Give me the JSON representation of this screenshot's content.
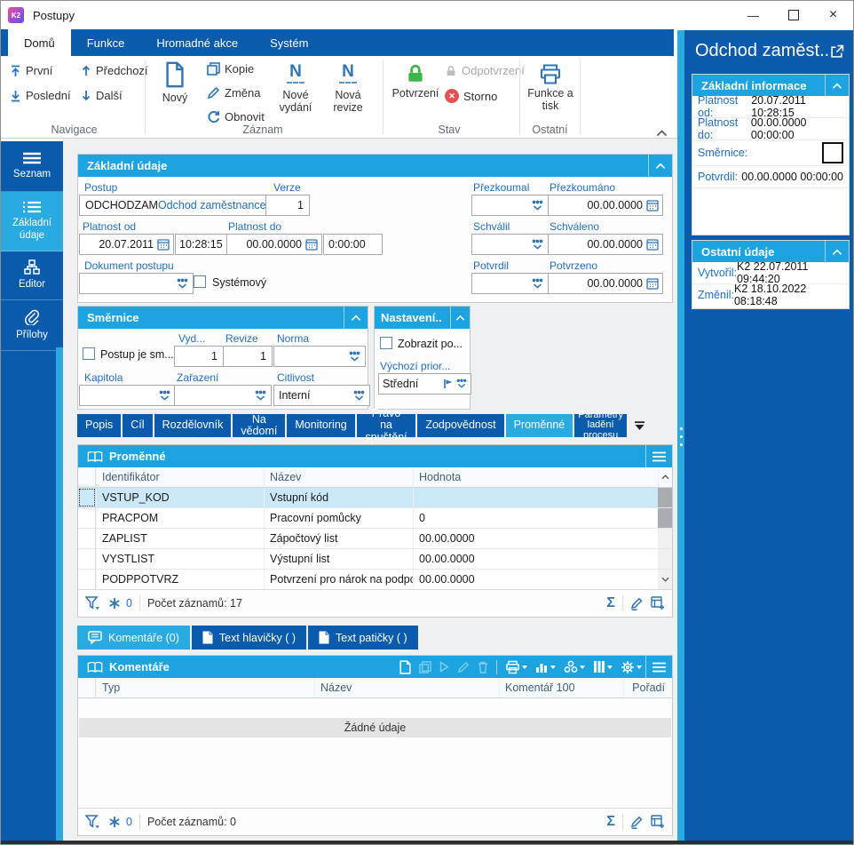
{
  "window": {
    "title": "Postupy",
    "logo_text": "K2"
  },
  "ribbon": {
    "tabs": [
      {
        "label": "Domů"
      },
      {
        "label": "Funkce"
      },
      {
        "label": "Hromadné akce"
      },
      {
        "label": "Systém"
      }
    ],
    "navigace": {
      "label": "Navigace",
      "prvni": "První",
      "posledni": "Poslední",
      "predchozi": "Předchozí",
      "dalsi": "Další"
    },
    "zaznam": {
      "label": "Záznam",
      "novy": "Nový",
      "kopie": "Kopie",
      "zmena": "Změna",
      "obnovit": "Obnovit",
      "nove_vydani": "Nové vydání",
      "nova_revize": "Nová revize"
    },
    "stav": {
      "label": "Stav",
      "potvrzeni": "Potvrzení",
      "odpotvrzeni": "Odpotvrzení",
      "storno": "Storno"
    },
    "ostatni": {
      "label": "Ostatní",
      "funkce_a_tisk": "Funkce a tisk"
    }
  },
  "sidebar": {
    "items": [
      {
        "label": "Seznam"
      },
      {
        "label": "Základní údaje"
      },
      {
        "label": "Editor"
      },
      {
        "label": "Přílohy"
      }
    ]
  },
  "form": {
    "title": "Základní údaje",
    "postup": {
      "label": "Postup",
      "code": "ODCHODZAM",
      "name": "Odchod zaměstnance"
    },
    "verze": {
      "label": "Verze",
      "value": "1"
    },
    "platnost_od": {
      "label": "Platnost od",
      "date": "20.07.2011",
      "time": "10:28:15"
    },
    "platnost_do": {
      "label": "Platnost do",
      "date": "00.00.0000",
      "time": "0:00:00"
    },
    "dokument": {
      "label": "Dokument postupu"
    },
    "systemovy": {
      "label": "Systémový"
    },
    "prezkoumal": {
      "label": "Přezkoumal"
    },
    "prezkoumano": {
      "label": "Přezkoumáno",
      "value": "00.00.0000"
    },
    "schvalil": {
      "label": "Schválil"
    },
    "schvaleno": {
      "label": "Schváleno",
      "value": "00.00.0000"
    },
    "potvrdil": {
      "label": "Potvrdil"
    },
    "potvrzeno": {
      "label": "Potvrzeno",
      "value": "00.00.0000"
    }
  },
  "smernice": {
    "title": "Směrnice",
    "postup_je": {
      "label": "Postup je sm..."
    },
    "vydani": {
      "label": "Vyd...",
      "value": "1"
    },
    "revize": {
      "label": "Revize",
      "value": "1"
    },
    "norma": {
      "label": "Norma"
    },
    "kapitola": {
      "label": "Kapitola"
    },
    "zarazeni": {
      "label": "Zařazení"
    },
    "citlivost": {
      "label": "Citlivost",
      "value": "Interní"
    }
  },
  "nastaveni": {
    "title": "Nastavení...",
    "zobrazit": {
      "label": "Zobrazit po..."
    },
    "priorita": {
      "label": "Výchozí prior...",
      "value": "Střední"
    }
  },
  "detail_tabs": [
    {
      "label": "Popis"
    },
    {
      "label": "Cíl"
    },
    {
      "label": "Rozdělovník"
    },
    {
      "label": "Na vědomí"
    },
    {
      "label": "Monitoring"
    },
    {
      "label": "Právo na spuštění"
    },
    {
      "label": "Zodpovědnost"
    },
    {
      "label": "Proměnné"
    },
    {
      "label": "Parametry ladění procesu"
    }
  ],
  "promenne": {
    "title": "Proměnné",
    "columns": {
      "identifikator": "Identifikátor",
      "nazev": "Název",
      "hodnota": "Hodnota"
    },
    "rows": [
      {
        "id": "VSTUP_KOD",
        "name": "Vstupní kód",
        "value": ""
      },
      {
        "id": "PRACPOM",
        "name": "Pracovní pomůcky",
        "value": "0"
      },
      {
        "id": "ZAPLIST",
        "name": "Zápočtový list",
        "value": "00.00.0000"
      },
      {
        "id": "VYSTLIST",
        "name": "Výstupní list",
        "value": "00.00.0000"
      },
      {
        "id": "PODPPOTVRZ",
        "name": "Potvrzení pro nárok na podporu",
        "value": "00.00.0000"
      }
    ],
    "footer": {
      "freeze": "0",
      "count": "Počet záznamů: 17"
    }
  },
  "comment_tabs": [
    {
      "label": "Komentáře (0)"
    },
    {
      "label": "Text hlavičky ( )"
    },
    {
      "label": "Text patičky ( )"
    }
  ],
  "komentare": {
    "title": "Komentáře",
    "columns": {
      "typ": "Typ",
      "nazev": "Název",
      "komentar": "Komentář 100",
      "poradi": "Pořadí"
    },
    "empty": "Žádné údaje",
    "footer": {
      "freeze": "0",
      "count": "Počet záznamů: 0"
    }
  },
  "right_panel": {
    "title": "Odchod zaměst...",
    "zakladni": {
      "title": "Základní informace",
      "rows": [
        {
          "label": "Platnost od:",
          "value": "20.07.2011 10:28:15"
        },
        {
          "label": "Platnost do:",
          "value": "00.00.0000 00:00:00"
        },
        {
          "label": "Směrnice:",
          "value": ""
        },
        {
          "label": "Potvrdil:",
          "value": "00.00.0000 00:00:00"
        }
      ]
    },
    "ostatni": {
      "title": "Ostatní údaje",
      "rows": [
        {
          "label": "Vytvořil:",
          "value": "K2 22.07.2011 09:44:20"
        },
        {
          "label": "Změnil:",
          "value": "K2 18.10.2022 08:18:48"
        }
      ]
    }
  },
  "colors": {
    "dark_blue": "#0b5bad",
    "header_cyan": "#1ba4e0",
    "active_cyan": "#29abe2",
    "label_blue": "#1f6fc0",
    "confirm_green": "#3cb54a",
    "storno_red": "#e25252",
    "selected_row": "#cbe8f9"
  }
}
